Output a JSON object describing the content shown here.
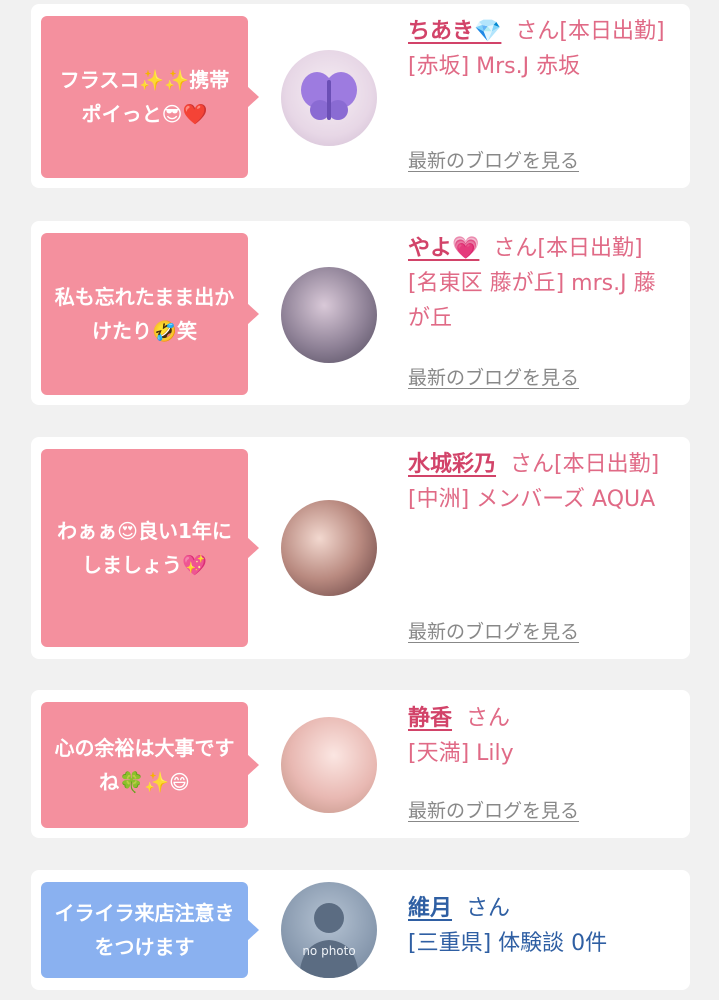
{
  "cards": [
    {
      "bubble": "フラスコ✨✨携帯ポイっと😎❤️",
      "name": "ちあき💎",
      "san": "さん",
      "status": "[本日出勤]",
      "shop": "[赤坂] Mrs.J 赤坂",
      "blog": "最新のブログを見る"
    },
    {
      "bubble": "私も忘れたまま出かけたり🤣笑",
      "name": "やよ💗",
      "san": "さん",
      "status": "[本日出勤]",
      "shop": "[名東区 藤が丘] mrs.J 藤が丘",
      "blog": "最新のブログを見る"
    },
    {
      "bubble": "わぁぁ😍良い1年にしましょう💖",
      "name": "水城彩乃",
      "san": "さん",
      "status": "[本日出勤]",
      "shop": "[中洲] メンバーズ AQUA",
      "blog": "最新のブログを見る"
    },
    {
      "bubble": "心の余裕は大事ですね🍀✨😄",
      "name": "静香",
      "san": "さん",
      "status": "",
      "shop": "[天満] Lily",
      "blog": "最新のブログを見る"
    },
    {
      "bubble": "イライラ来店注意きをつけます",
      "name": "維月",
      "san": "さん",
      "status": "",
      "shop": "[三重県] 体験談 0件",
      "blog": "",
      "avatar_text": "no photo"
    }
  ],
  "colors": {
    "pink_bubble": "#f4909e",
    "blue_bubble": "#8ab1f0",
    "pink_text": "#e06a86",
    "blue_text": "#2f5fa3"
  },
  "icons": [
    "butterfly-avatar-image",
    "person-silhouette-icon"
  ]
}
